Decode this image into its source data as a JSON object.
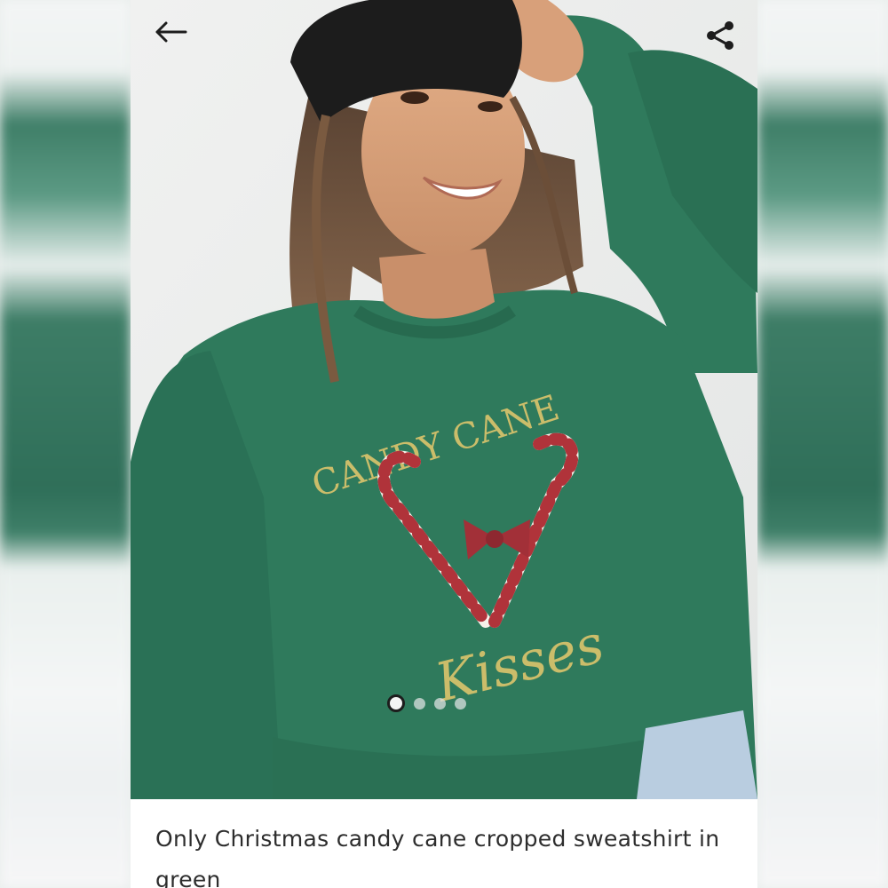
{
  "header": {
    "back_icon": "arrow-left-icon",
    "share_icon": "share-icon"
  },
  "gallery": {
    "image_count": 4,
    "active_index": 0,
    "print_text_top": "CANDY CANE",
    "print_text_bottom": "Kisses"
  },
  "product": {
    "title": "Only Christmas candy cane cropped sweatshirt in green"
  },
  "colors": {
    "sweatshirt": "#2f7a5c",
    "print_gold": "#cbbd6a",
    "candy_red": "#b0333a",
    "beanie": "#1c1c1c",
    "text": "#2d2d2d"
  }
}
